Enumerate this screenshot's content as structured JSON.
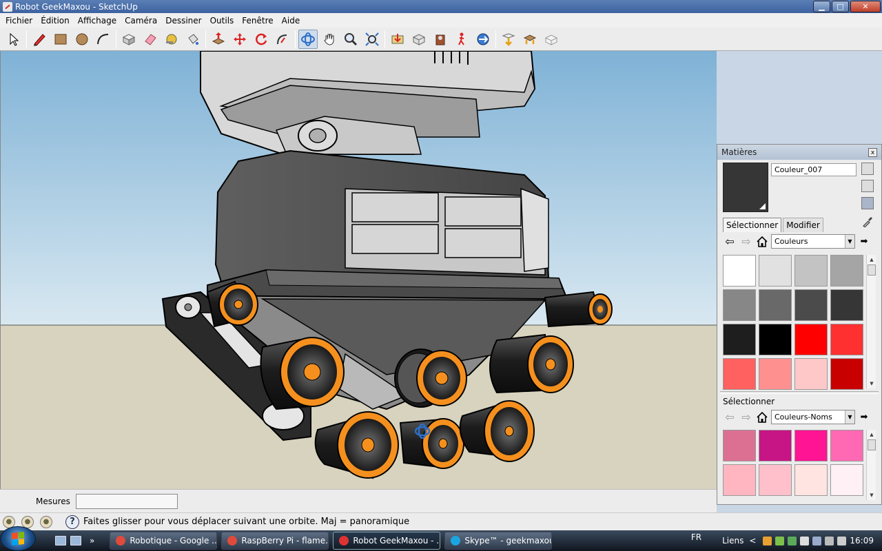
{
  "window": {
    "title": "Robot GeekMaxou - SketchUp",
    "min": "▁",
    "max": "□",
    "close": "✕"
  },
  "menu": [
    "Fichier",
    "Édition",
    "Affichage",
    "Caméra",
    "Dessiner",
    "Outils",
    "Fenêtre",
    "Aide"
  ],
  "toolbar": {
    "tools": [
      "select-icon",
      "pencil-icon",
      "rectangle-icon",
      "circle-icon",
      "arc-icon",
      "make-component-icon",
      "eraser-icon",
      "tape-measure-icon",
      "paint-bucket-icon",
      "push-pull-icon",
      "move-icon",
      "rotate-icon",
      "follow-me-icon",
      "orbit-icon",
      "pan-icon",
      "zoom-icon",
      "zoom-extents-icon",
      "get-models-icon",
      "share-model-icon",
      "get-components-icon",
      "walk-icon",
      "look-around-icon",
      "share-component-icon",
      "preview-google-earth-icon",
      "toggle-terrain-icon"
    ],
    "active_tool": "orbit-icon"
  },
  "measurements": {
    "label": "Mesures",
    "value": ""
  },
  "status": {
    "text": "Faites glisser pour vous déplacer suivant une orbite.  Maj = panoramique",
    "help": "?"
  },
  "materials": {
    "title": "Matières",
    "close": "x",
    "current_name": "Couleur_007",
    "current_color": "#363636",
    "tab_select": "Sélectionner",
    "tab_modify": "Modifier",
    "library": "Couleurs",
    "swatches": [
      "#ffffff",
      "#e1e1e1",
      "#c3c3c3",
      "#a5a5a5",
      "#878787",
      "#696969",
      "#4b4b4b",
      "#363636",
      "#1e1e1e",
      "#000000",
      "#ff0000",
      "#ff3030",
      "#ff6060",
      "#ff9090",
      "#ffc8c8",
      "#c80000"
    ],
    "section2_label": "Sélectionner",
    "library2": "Couleurs-Noms",
    "swatches2": [
      "#db7093",
      "#c71585",
      "#ff1493",
      "#ff69b4",
      "#ffb6c1",
      "#ffc0cb",
      "#ffe4e1",
      "#fff0f5"
    ]
  },
  "taskbar": {
    "more": "»",
    "tasks": [
      {
        "label": "Robotique - Google ...",
        "icon_color": "#e04a3c",
        "active": false
      },
      {
        "label": "RaspBerry Pi - flame...",
        "icon_color": "#e04a3c",
        "active": false
      },
      {
        "label": "Robot GeekMaxou - ...",
        "icon_color": "#d33",
        "active": true
      },
      {
        "label": "Skype™ - geekmaxou",
        "icon_color": "#1ba5e0",
        "active": false
      }
    ],
    "lang": "FR",
    "links": "Liens",
    "chevron": "<",
    "clock": "16:09"
  },
  "colors": {
    "sky": "#8fbcd9",
    "ground": "#d7d3bf",
    "accent_orange": "#f5901e"
  }
}
